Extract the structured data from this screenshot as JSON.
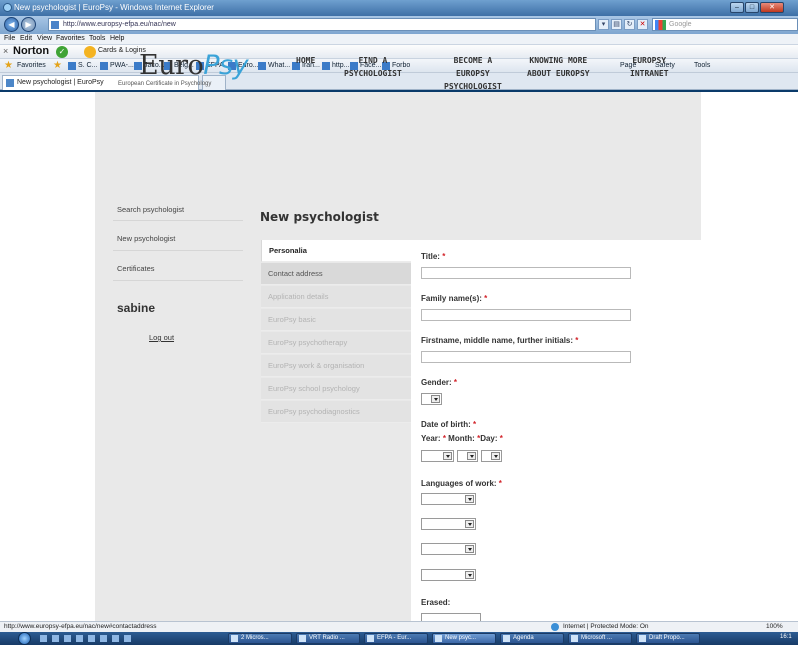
{
  "window": {
    "title": "New psychologist | EuroPsy - Windows Internet Explorer",
    "minimize": "–",
    "maximize": "□",
    "close": "✕"
  },
  "address_bar": {
    "url": "http://www.europsy-efpa.eu/nac/new",
    "search_placeholder": "Google"
  },
  "menu": [
    "File",
    "Edit",
    "View",
    "Favorites",
    "Tools",
    "Help"
  ],
  "norton": {
    "brand": "Norton",
    "cards": "Cards & Logins"
  },
  "favorites": {
    "label": "Favorites",
    "items": [
      "S. C...",
      "PWA-...",
      "Jaco...",
      "Belg...",
      "EFPA...",
      "Euro...",
      "What...",
      "Iran...",
      "http...",
      "Face...",
      "Forbo"
    ],
    "tools": [
      "Page",
      "Safety",
      "Tools"
    ]
  },
  "tab": {
    "label": "New psychologist | EuroPsy"
  },
  "site": {
    "logo_main": "Euro",
    "logo_accent": "Psy",
    "logo_sub": "European Certificate in Psychology",
    "nav": [
      {
        "line1": "HOME",
        "line2": "",
        "line3": ""
      },
      {
        "line1": "FIND A",
        "line2": "PSYCHOLOGIST",
        "line3": ""
      },
      {
        "line1": "BECOME A",
        "line2": "EUROPSY",
        "line3": "PSYCHOLOGIST"
      },
      {
        "line1": "KNOWING MORE",
        "line2": "ABOUT EUROPSY",
        "line3": ""
      },
      {
        "line1": "EUROPSY",
        "line2": "INTRANET",
        "line3": ""
      }
    ],
    "sidebar": [
      "Search psychologist",
      "New psychologist",
      "Certificates"
    ],
    "user": "sabine",
    "logout": "Log out",
    "page_title": "New psychologist",
    "vtabs": [
      "Personalia",
      "Contact address",
      "Application details",
      "EuroPsy basic",
      "EuroPsy psychotherapy",
      "EuroPsy work & organisation",
      "EuroPsy school psychology",
      "EuroPsy psychodiagnostics"
    ],
    "form": {
      "title_label": "Title:",
      "family_label": "Family name(s):",
      "first_label": "Firstname, middle name, further initials:",
      "gender_label": "Gender:",
      "dob_label": "Date of birth:",
      "year_label": "Year:",
      "month_label": "Month:",
      "day_label": "Day:",
      "languages_label": "Languages of work:",
      "erased_label": "Erased:",
      "required_mark": "*"
    }
  },
  "status": {
    "url": "http://www.europsy-efpa.eu/nac/new#contactaddress",
    "zone": "Internet | Protected Mode: On",
    "zoom": "100%"
  },
  "taskbar": {
    "items": [
      "2 Micros...",
      "VRT Radio ...",
      "EFPA - Eur...",
      "New psyc...",
      "Agenda",
      "Microsoft ...",
      "Draft Propo..."
    ],
    "clock": "16:1"
  }
}
